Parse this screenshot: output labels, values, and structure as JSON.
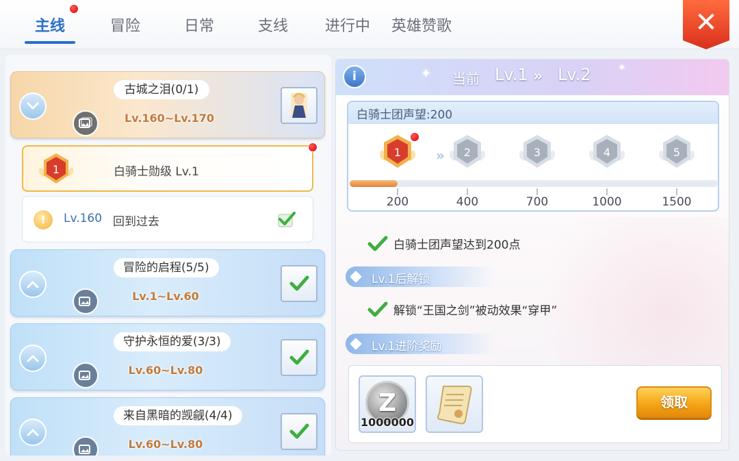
{
  "tabs": [
    {
      "label": "主线",
      "active": true,
      "has_notification": true
    },
    {
      "label": "冒险",
      "active": false
    },
    {
      "label": "日常",
      "active": false
    },
    {
      "label": "支线",
      "active": false
    },
    {
      "label": "进行中",
      "active": false
    },
    {
      "label": "英雄赞歌",
      "active": false
    }
  ],
  "close_icon": "close-x-icon",
  "left": {
    "chapters": [
      {
        "title": "古城之泪(0/1)",
        "range": "Lv.160~Lv.170",
        "expanded": true,
        "completed": false
      },
      {
        "title": "冒险的启程(5/5)",
        "range": "Lv.1~Lv.60",
        "expanded": false,
        "completed": true
      },
      {
        "title": "守护永恒的爱(3/3)",
        "range": "Lv.60~Lv.80",
        "expanded": false,
        "completed": true
      },
      {
        "title": "来自黑暗的觊觎(4/4)",
        "range": "Lv.60~Lv.80",
        "expanded": false,
        "completed": true
      }
    ],
    "quests": [
      {
        "medal_number": "1",
        "name": "白骑士勋级 Lv.1",
        "selected": true,
        "has_notification": true
      },
      {
        "level": "Lv.160",
        "name": "回到过去",
        "completed": true
      }
    ]
  },
  "right": {
    "header": {
      "current_label": "当前",
      "from_level": "Lv.1",
      "arrow": "»",
      "to_level": "Lv.2"
    },
    "reputation": {
      "title": "白骑士团声望:200",
      "tiers": [
        "1",
        "2",
        "3",
        "4",
        "5"
      ],
      "thresholds": [
        "200",
        "400",
        "700",
        "1000",
        "1500"
      ],
      "current_value": 200,
      "progress_fraction": 0.13,
      "arrow": "»"
    },
    "requirement": "白骑士团声望达到200点",
    "unlock_section": "Lv.1后解锁",
    "unlock_text": "解锁“王国之剑”被动效果“穿甲”",
    "reward_section": "Lv.1进阶奖励",
    "rewards": [
      {
        "icon": "zeny-coin-icon",
        "letter": "Z",
        "amount": "1000000"
      },
      {
        "icon": "scroll-icon"
      }
    ],
    "claim_button": "领取"
  },
  "colors": {
    "accent_blue": "#2a6fc9",
    "claim_orange": "#f4a315",
    "close_red": "#d9301c"
  }
}
